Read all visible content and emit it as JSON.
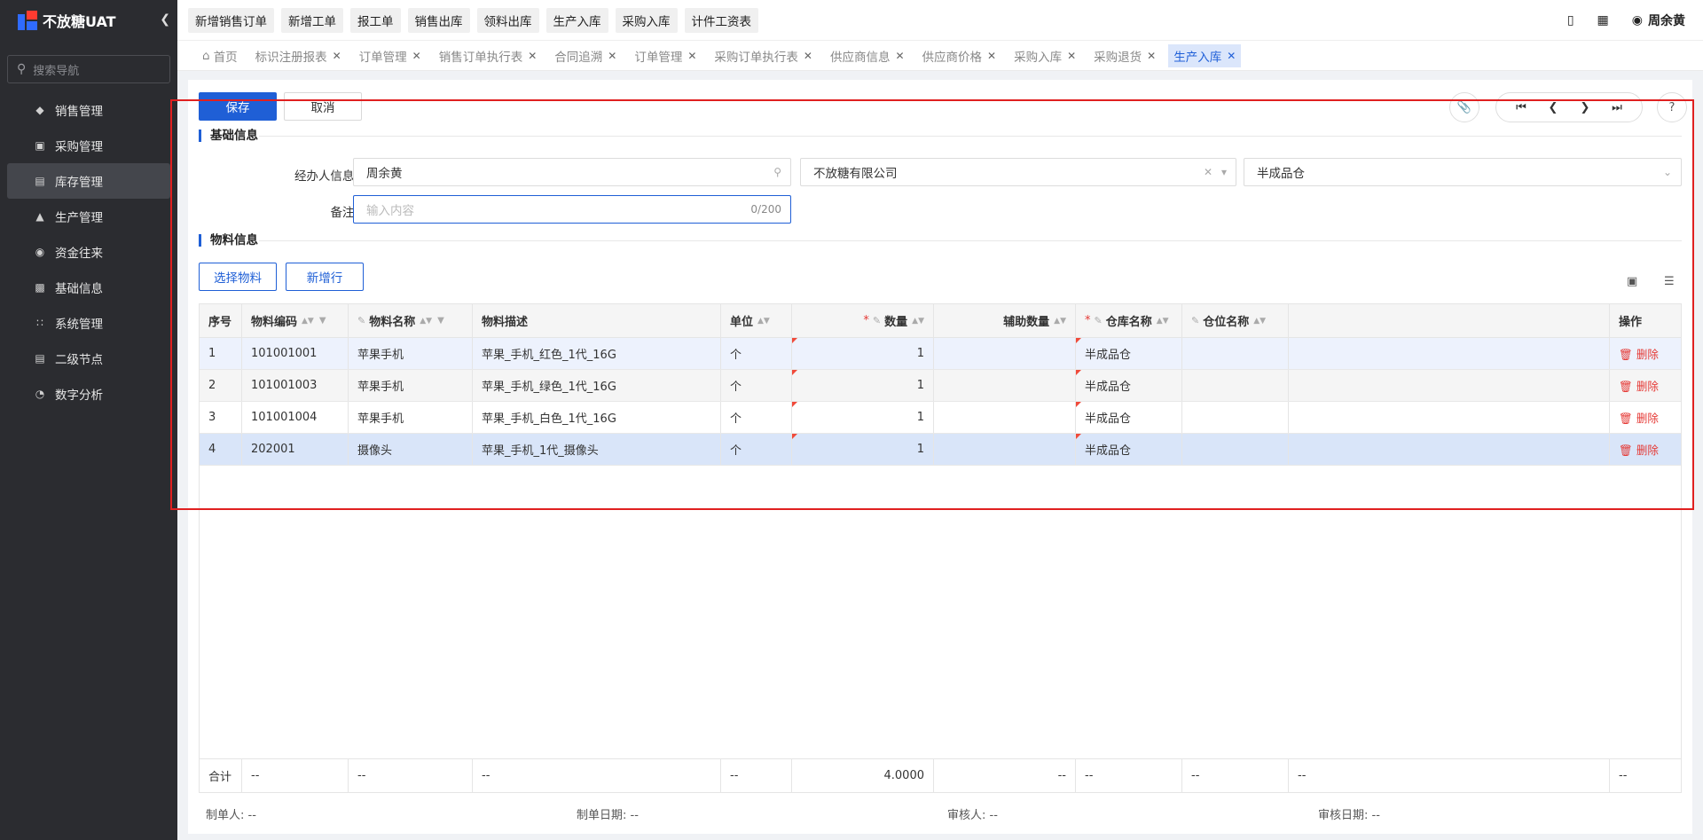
{
  "app": {
    "logo_text": "不放糖UAT"
  },
  "sidebar": {
    "search_placeholder": "搜索导航",
    "items": [
      {
        "label": "销售管理",
        "icon": "tag-icon"
      },
      {
        "label": "采购管理",
        "icon": "cart-icon"
      },
      {
        "label": "库存管理",
        "icon": "warehouse-icon",
        "active": true
      },
      {
        "label": "生产管理",
        "icon": "factory-icon"
      },
      {
        "label": "资金往来",
        "icon": "money-icon"
      },
      {
        "label": "基础信息",
        "icon": "grid-icon"
      },
      {
        "label": "系统管理",
        "icon": "apps-icon"
      },
      {
        "label": "二级节点",
        "icon": "doc-icon"
      },
      {
        "label": "数字分析",
        "icon": "piechart-icon"
      }
    ]
  },
  "topbar": {
    "quick_buttons": [
      "新增销售订单",
      "新增工单",
      "报工单",
      "销售出库",
      "领料出库",
      "生产入库",
      "采购入库",
      "计件工资表"
    ],
    "user_name": "周余黄"
  },
  "tabs": [
    {
      "label": "首页",
      "closable": false
    },
    {
      "label": "标识注册报表",
      "closable": true
    },
    {
      "label": "订单管理",
      "closable": true
    },
    {
      "label": "销售订单执行表",
      "closable": true
    },
    {
      "label": "合同追溯",
      "closable": true
    },
    {
      "label": "订单管理",
      "closable": true
    },
    {
      "label": "采购订单执行表",
      "closable": true
    },
    {
      "label": "供应商信息",
      "closable": true
    },
    {
      "label": "供应商价格",
      "closable": true
    },
    {
      "label": "采购入库",
      "closable": true
    },
    {
      "label": "采购退货",
      "closable": true
    },
    {
      "label": "生产入库",
      "closable": true,
      "active": true
    }
  ],
  "toolbar": {
    "save_label": "保存",
    "cancel_label": "取消"
  },
  "basic_info": {
    "title": "基础信息",
    "handler_label": "经办人信息:",
    "handler_value": "周余黄",
    "company_value": "不放糖有限公司",
    "warehouse_value": "半成品仓",
    "remark_label": "备注:",
    "remark_placeholder": "输入内容",
    "remark_count": "0/200"
  },
  "material_info": {
    "title": "物料信息",
    "select_material_label": "选择物料",
    "add_row_label": "新增行"
  },
  "table": {
    "headers": {
      "seq": "序号",
      "code": "物料编码",
      "name": "物料名称",
      "desc": "物料描述",
      "unit": "单位",
      "qty": "数量",
      "aux_qty": "辅助数量",
      "warehouse": "仓库名称",
      "location": "仓位名称",
      "blank": "",
      "action": "操作"
    },
    "rows": [
      {
        "seq": "1",
        "code": "101001001",
        "name": "苹果手机",
        "desc": "苹果_手机_红色_1代_16G",
        "unit": "个",
        "qty": "1",
        "aux_qty": "",
        "warehouse": "半成品仓",
        "location": "",
        "action": "删除"
      },
      {
        "seq": "2",
        "code": "101001003",
        "name": "苹果手机",
        "desc": "苹果_手机_绿色_1代_16G",
        "unit": "个",
        "qty": "1",
        "aux_qty": "",
        "warehouse": "半成品仓",
        "location": "",
        "action": "删除"
      },
      {
        "seq": "3",
        "code": "101001004",
        "name": "苹果手机",
        "desc": "苹果_手机_白色_1代_16G",
        "unit": "个",
        "qty": "1",
        "aux_qty": "",
        "warehouse": "半成品仓",
        "location": "",
        "action": "删除"
      },
      {
        "seq": "4",
        "code": "202001",
        "name": "摄像头",
        "desc": "苹果_手机_1代_摄像头",
        "unit": "个",
        "qty": "1",
        "aux_qty": "",
        "warehouse": "半成品仓",
        "location": "",
        "action": "删除"
      }
    ],
    "summary": {
      "label": "合计",
      "code": "--",
      "name": "--",
      "desc": "--",
      "unit": "--",
      "qty": "4.0000",
      "aux_qty": "--",
      "warehouse": "--",
      "location": "--",
      "blank": "--",
      "action": "--"
    }
  },
  "footer": {
    "creator_label": "制单人:",
    "creator_value": "--",
    "created_date_label": "制单日期:",
    "created_date_value": "--",
    "auditor_label": "审核人:",
    "auditor_value": "--",
    "audit_date_label": "审核日期:",
    "audit_date_value": "--"
  }
}
